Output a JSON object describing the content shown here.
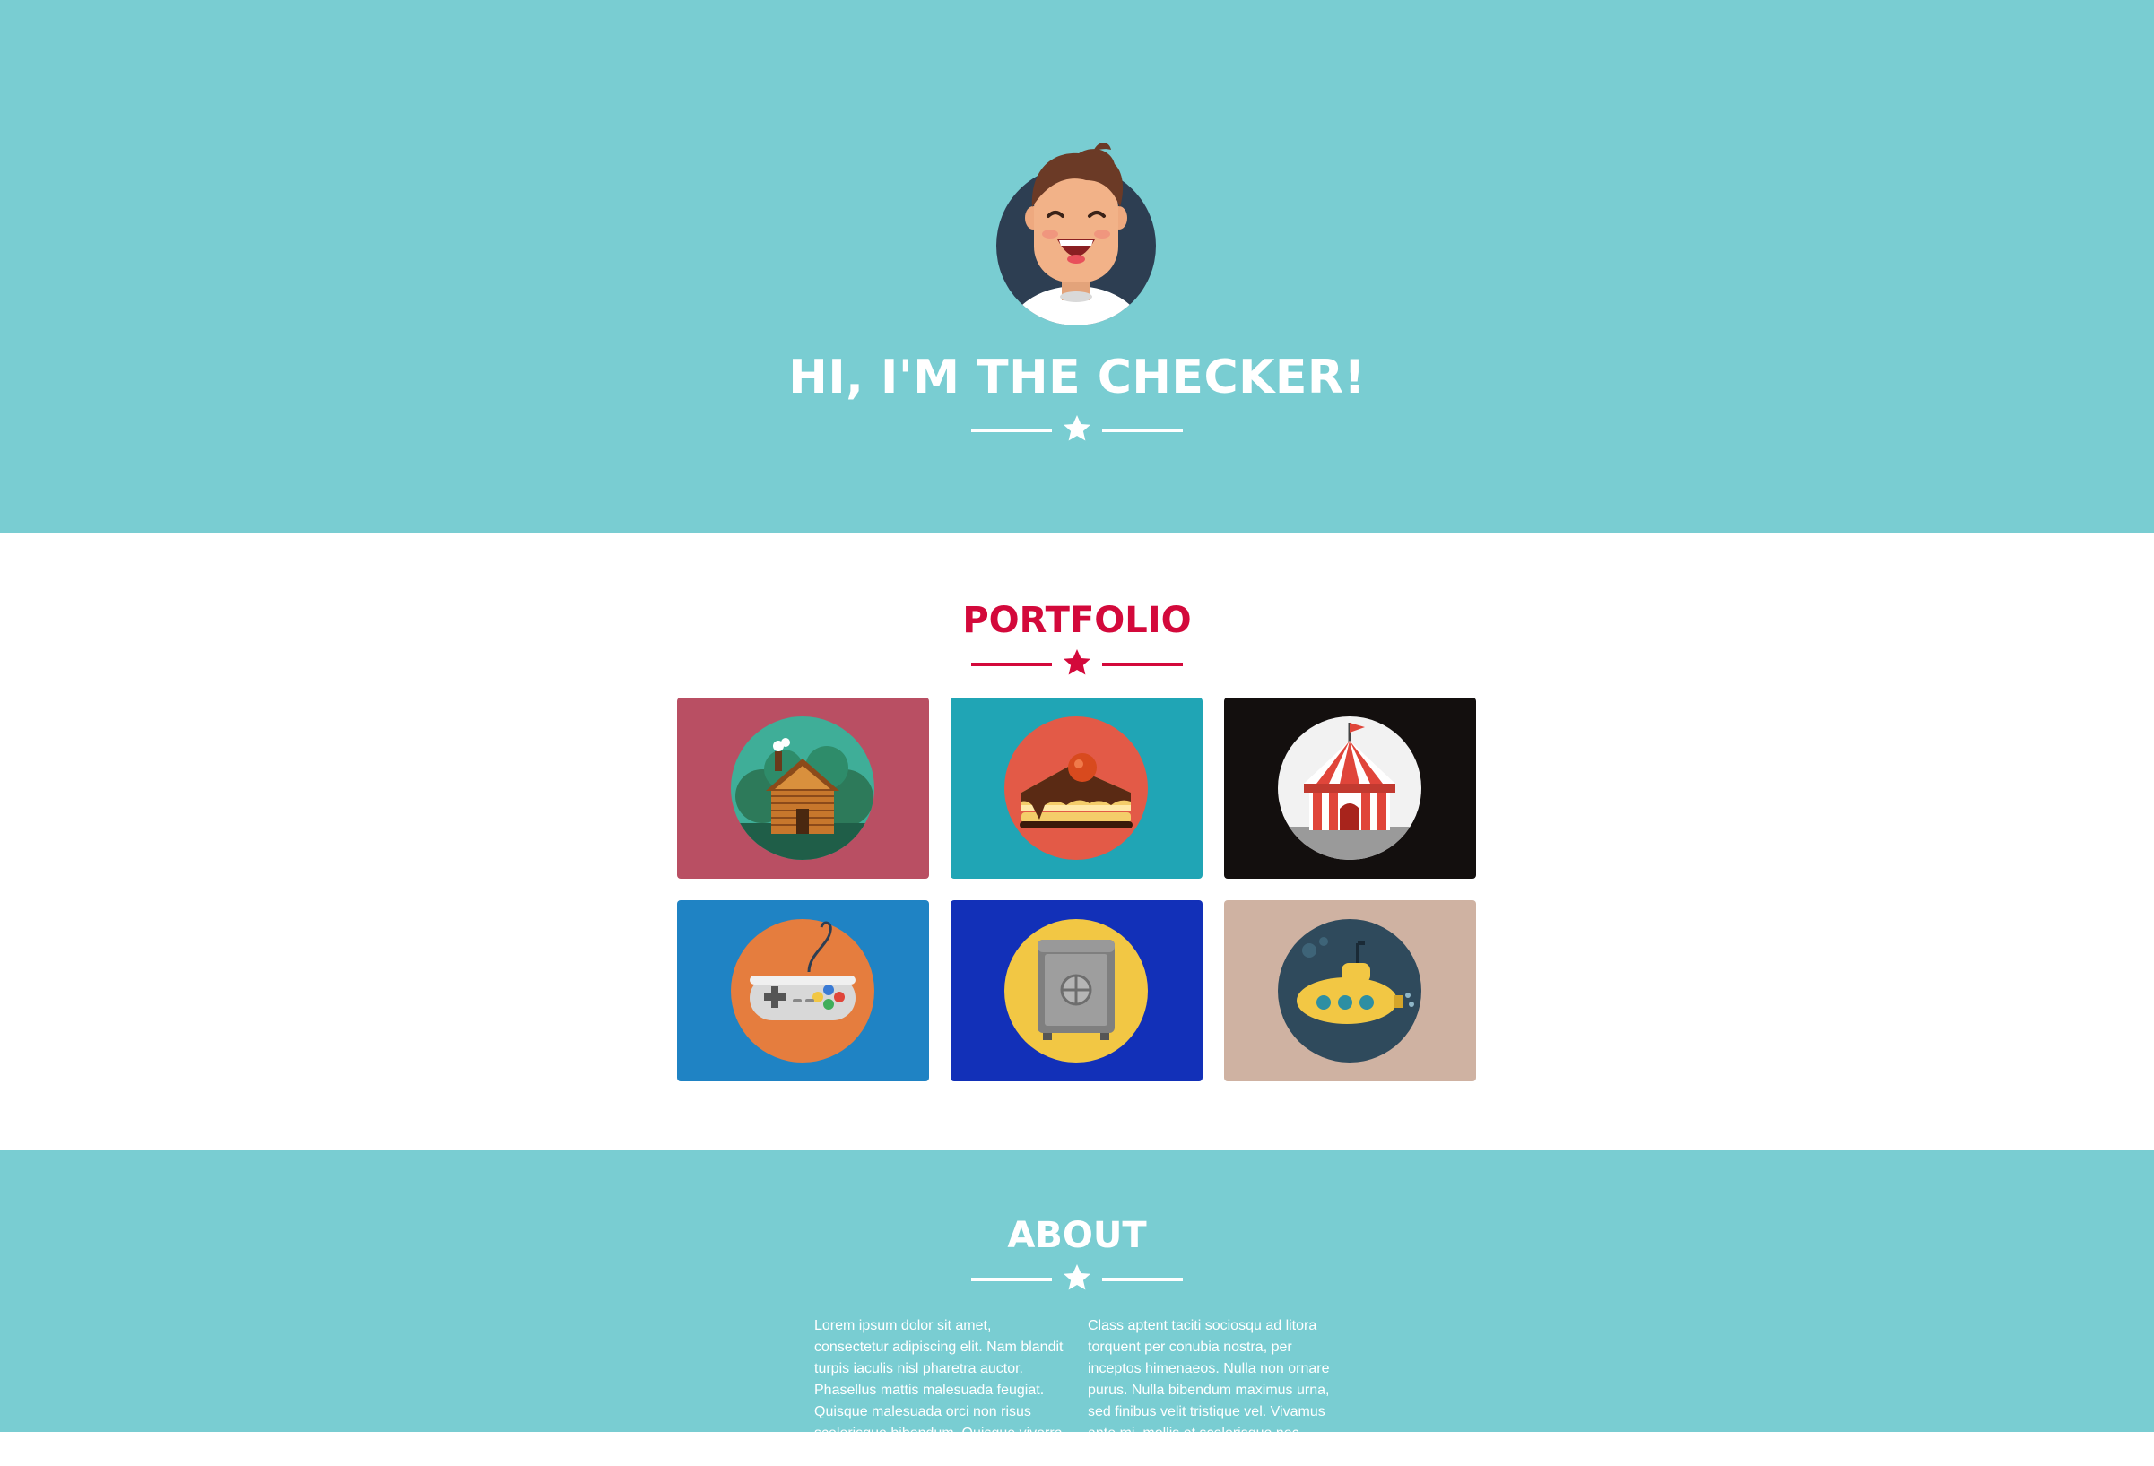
{
  "hero": {
    "title": "HI, I'M THE CHECKER!",
    "avatar_icon": "laughing-man-avatar-icon",
    "background": "#79cdd2"
  },
  "portfolio": {
    "title": "PORTFOLIO",
    "accent": "#d3093b",
    "items": [
      {
        "icon": "log-cabin-icon",
        "background": "#b94f63"
      },
      {
        "icon": "cake-slice-icon",
        "background": "#20a5b5"
      },
      {
        "icon": "circus-tent-icon",
        "background": "#130f0e"
      },
      {
        "icon": "game-controller-icon",
        "background": "#1f83c4"
      },
      {
        "icon": "safe-icon",
        "background": "#1230b8"
      },
      {
        "icon": "submarine-icon",
        "background": "#cfb2a2"
      }
    ]
  },
  "about": {
    "title": "ABOUT",
    "col1": "Lorem ipsum dolor sit amet, consectetur adipiscing elit. Nam blandit turpis iaculis nisl pharetra auctor. Phasellus mattis malesuada feugiat. Quisque malesuada orci non risus scelerisque bibendum. Quisque viverra vulputate posuere.",
    "col2": "Class aptent taciti sociosqu ad litora torquent per conubia nostra, per inceptos himenaeos. Nulla non ornare purus. Nulla bibendum maximus urna, sed finibus velit tristique vel. Vivamus ante mi, mollis et scelerisque nec."
  }
}
